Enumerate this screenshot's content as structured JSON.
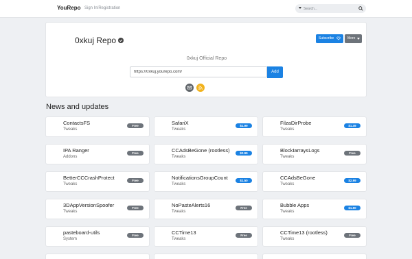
{
  "navbar": {
    "brand": "YouRepo",
    "sign_in_label": "Sign In/Registration",
    "search_placeholder": "Search..."
  },
  "repo": {
    "title": "0xkuj Repo",
    "subscribe_label": "Subscribe",
    "more_label": "More",
    "description": "0xkuj Official Repo",
    "url": "https://0xkuj.yourepo.com/",
    "add_label": "Add"
  },
  "news": {
    "title": "News and updates",
    "packages": [
      {
        "name": "ContactsFS",
        "section": "Tweaks",
        "price": "Free",
        "paid": false
      },
      {
        "name": "SafariX",
        "section": "Tweaks",
        "price": "$1.99",
        "paid": true
      },
      {
        "name": "FilzaDirProbe",
        "section": "Tweaks",
        "price": "$1.49",
        "paid": true
      },
      {
        "name": "IPA Ranger",
        "section": "Addons",
        "price": "Free",
        "paid": false
      },
      {
        "name": "CCAdsBeGone (rootless)",
        "section": "Tweaks",
        "price": "$2.99",
        "paid": true
      },
      {
        "name": "BlockIarraysLogs",
        "section": "Tweaks",
        "price": "Free",
        "paid": false
      },
      {
        "name": "BetterCCCrashProtect",
        "section": "Tweaks",
        "price": "Free",
        "paid": false
      },
      {
        "name": "NotificationsGroupCount",
        "section": "Tweaks",
        "price": "$1.50",
        "paid": true
      },
      {
        "name": "CCAdsBeGone",
        "section": "Tweaks",
        "price": "$2.99",
        "paid": true
      },
      {
        "name": "3DAppVersionSpoofer",
        "section": "Tweaks",
        "price": "Free",
        "paid": false
      },
      {
        "name": "NoPasteAlerts16",
        "section": "Tweaks",
        "price": "Free",
        "paid": false
      },
      {
        "name": "Bubble Apps",
        "section": "Tweaks",
        "price": "$1.50",
        "paid": true
      },
      {
        "name": "pasteboard-utils",
        "section": "System",
        "price": "Free",
        "paid": false
      },
      {
        "name": "CCTime13",
        "section": "Tweaks",
        "price": "Free",
        "paid": false
      },
      {
        "name": "CCTime13 (rootless)",
        "section": "Tweaks",
        "price": "Free",
        "paid": false
      }
    ]
  },
  "colors": {
    "primary": "#1b82e3",
    "secondary": "#6d737a",
    "rss": "#f2b21b",
    "background": "#eef0f3"
  },
  "icons": {
    "verified": "check-circle-icon",
    "subscribe": "heart-icon",
    "search": "search-icon",
    "email": "envelope-icon",
    "rss": "rss-icon"
  }
}
